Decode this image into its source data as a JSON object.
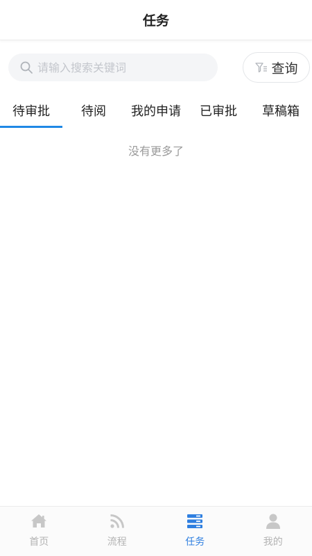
{
  "header": {
    "title": "任务"
  },
  "search": {
    "placeholder": "请输入搜索关键词",
    "value": "",
    "query_label": "查询"
  },
  "tabs": [
    {
      "label": "待审批",
      "active": true
    },
    {
      "label": "待阅",
      "active": false
    },
    {
      "label": "我的申请",
      "active": false
    },
    {
      "label": "已审批",
      "active": false
    },
    {
      "label": "草稿箱",
      "active": false
    }
  ],
  "empty_text": "没有更多了",
  "bottom_nav": [
    {
      "label": "首页",
      "icon": "home-icon",
      "active": false
    },
    {
      "label": "流程",
      "icon": "rss-icon",
      "active": false
    },
    {
      "label": "任务",
      "icon": "task-list-icon",
      "active": true
    },
    {
      "label": "我的",
      "icon": "user-icon",
      "active": false
    }
  ],
  "colors": {
    "accent": "#1f88e5",
    "nav_active": "#2f7fe0",
    "nav_inactive": "#b3b3b3",
    "placeholder": "#c3c6cc"
  }
}
